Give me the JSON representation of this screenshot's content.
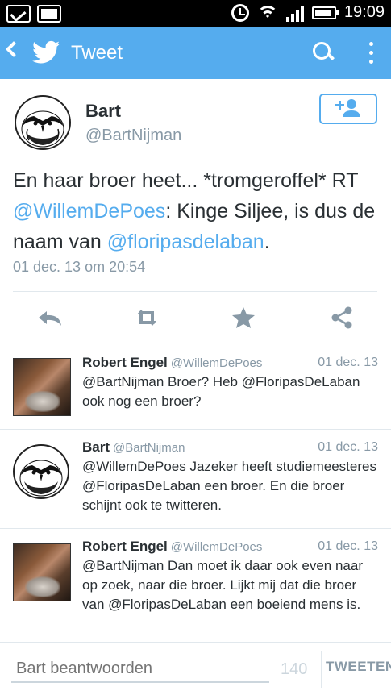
{
  "status_bar": {
    "time": "19:09"
  },
  "action_bar": {
    "title": "Tweet"
  },
  "tweet": {
    "author_name": "Bart",
    "author_handle": "@BartNijman",
    "text_parts": {
      "p1": "En haar broer heet... *tromgeroffel* RT ",
      "m1": "@WillemDePoes",
      "p2": ": Kinge Siljee, is dus de naam van ",
      "m2": "@floripasdelaban",
      "p3": "."
    },
    "timestamp": "01 dec. 13 om 20:54"
  },
  "replies": [
    {
      "name": "Robert Engel",
      "handle": "@WillemDePoes",
      "date": "01 dec. 13",
      "text": "@BartNijman Broer? Heb @FloripasDeLaban ook nog een broer?"
    },
    {
      "name": "Bart",
      "handle": "@BartNijman",
      "date": "01 dec. 13",
      "text": "@WillemDePoes Jazeker heeft studiemeesteres @FloripasDeLaban een broer. En die broer schijnt ook te twitteren."
    },
    {
      "name": "Robert Engel",
      "handle": "@WillemDePoes",
      "date": "01 dec. 13",
      "text": "@BartNijman Dan moet ik daar ook even naar op zoek, naar die broer. Lijkt mij dat die broer van @FloripasDeLaban een boeiend mens is."
    }
  ],
  "compose": {
    "placeholder": "Bart beantwoorden",
    "counter": "140",
    "send_label": "TWEETEN"
  },
  "colors": {
    "accent": "#55acee",
    "muted": "#8899a6",
    "text": "#292f33"
  },
  "icons": [
    "clipboard-icon",
    "image-icon",
    "alarm-icon",
    "wifi-icon",
    "signal-icon",
    "battery-icon",
    "back-icon",
    "twitter-bird-icon",
    "search-icon",
    "overflow-menu-icon",
    "follow-user-icon",
    "reply-icon",
    "retweet-icon",
    "favorite-icon",
    "share-icon"
  ]
}
